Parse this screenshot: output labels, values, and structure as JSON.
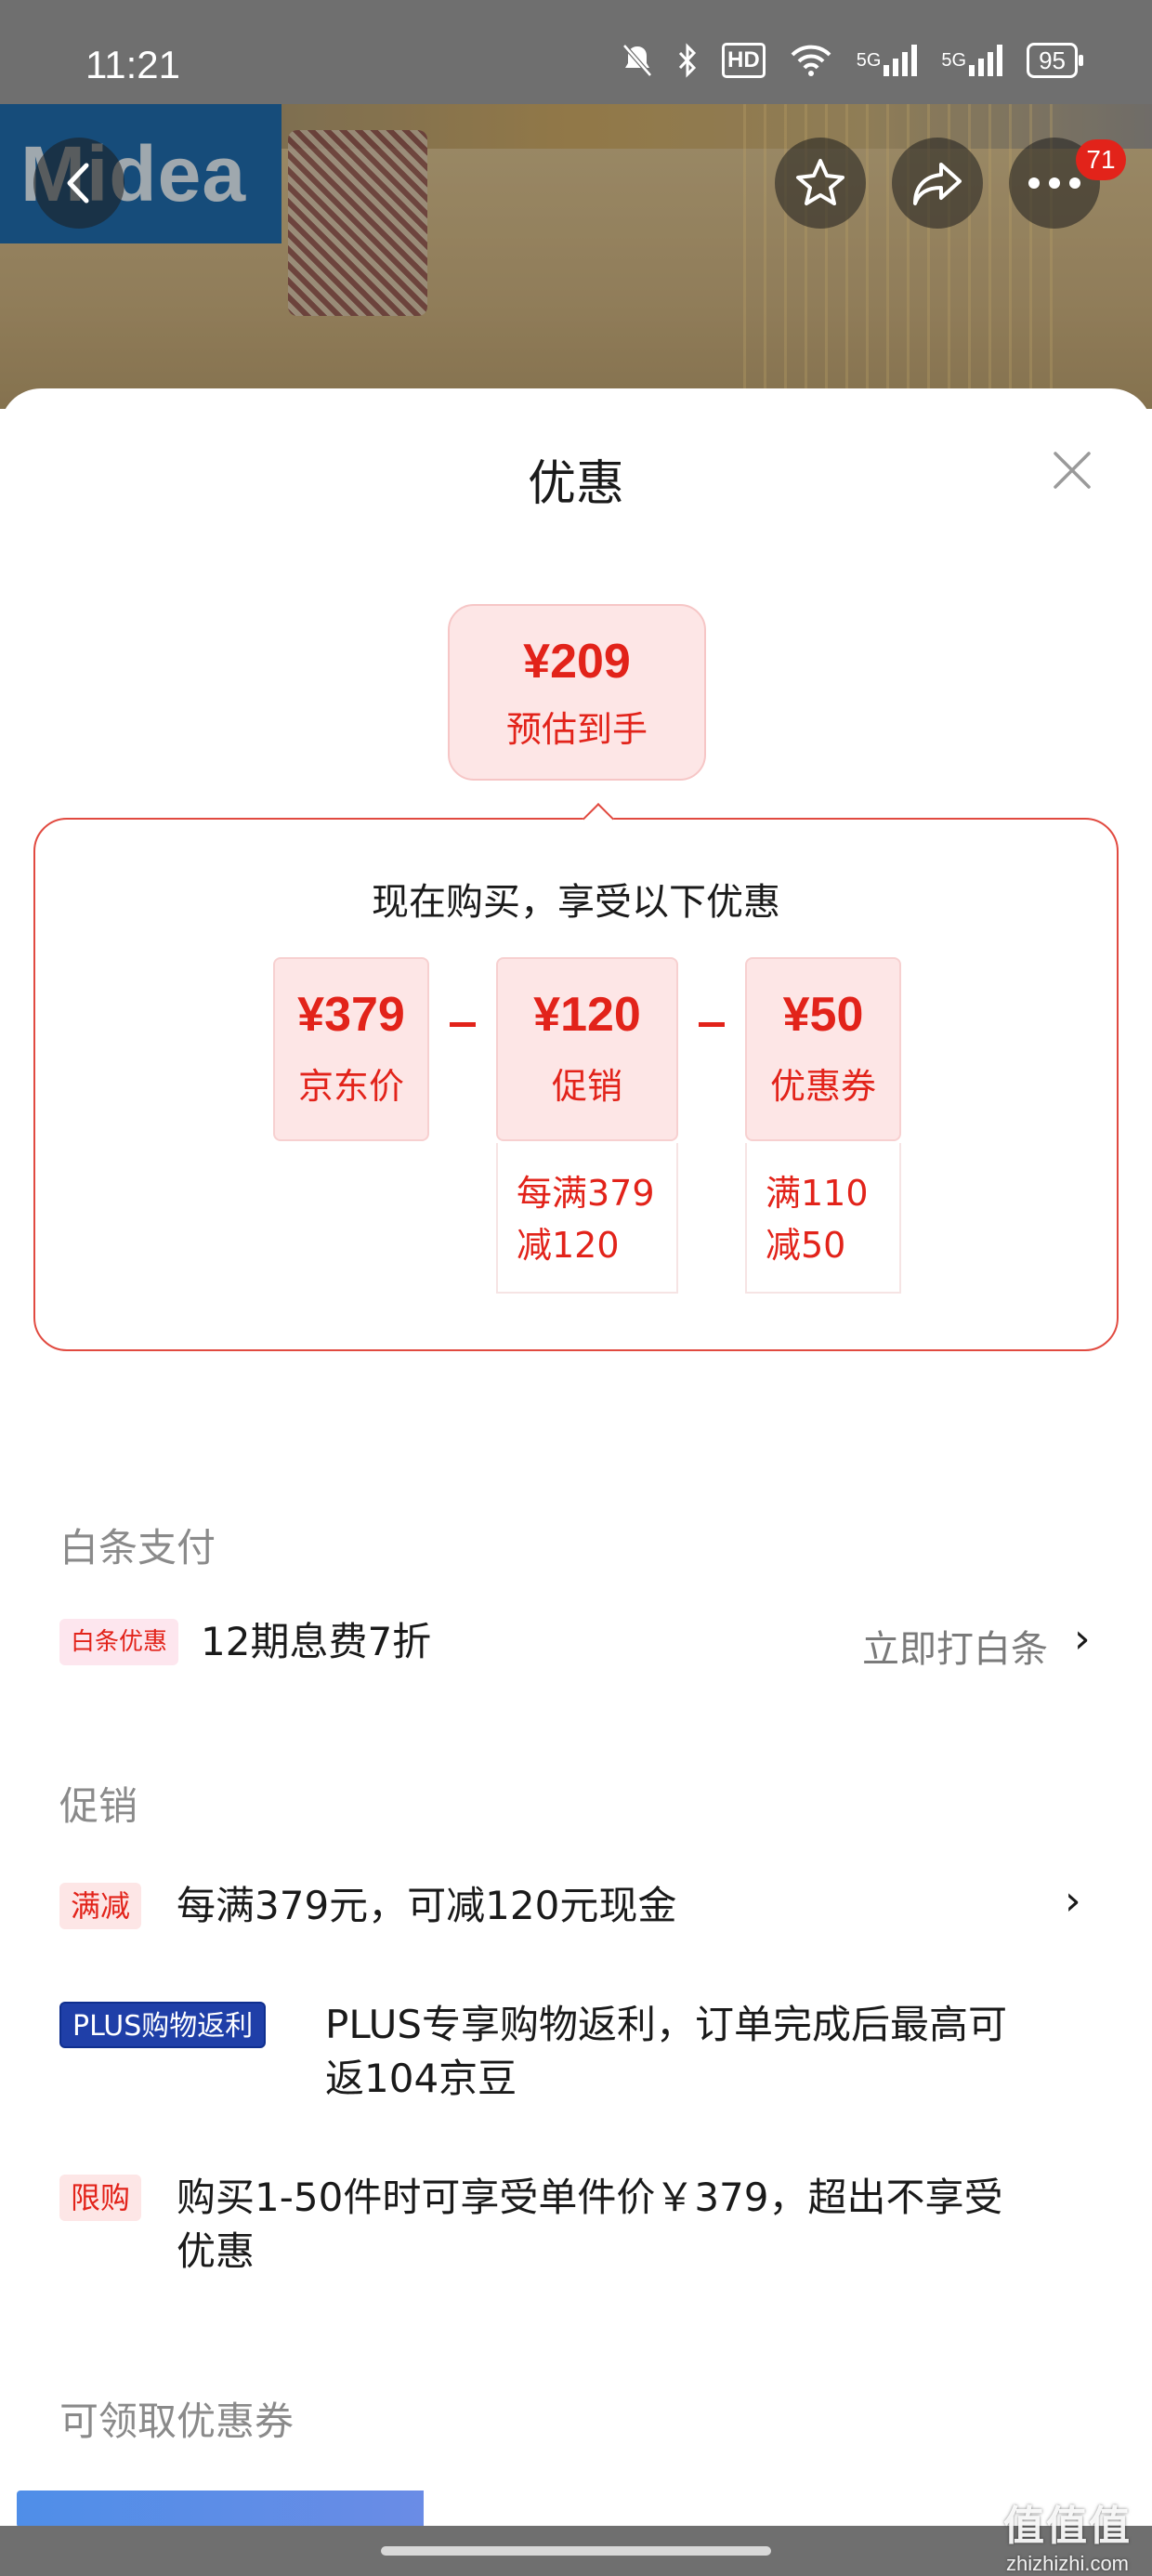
{
  "status_bar": {
    "time": "11:21",
    "battery": "95",
    "hd": "HD",
    "net1": "5G",
    "net2": "5G"
  },
  "header": {
    "brand_logo_text": "Midea",
    "cart_badge": "71"
  },
  "sheet": {
    "title": "优惠"
  },
  "estimate": {
    "price": "¥209",
    "label": "预估到手"
  },
  "calc": {
    "headline": "现在购买，享受以下优惠",
    "items": [
      {
        "value": "¥379",
        "label": "京东价",
        "detail": ""
      },
      {
        "value": "¥120",
        "label": "促销",
        "detail_line1": "每满379",
        "detail_line2": "减120"
      },
      {
        "value": "¥50",
        "label": "优惠券",
        "detail_line1": "满110",
        "detail_line2": "减50"
      }
    ]
  },
  "baitiao": {
    "section_title": "白条支付",
    "tag": "白条优惠",
    "text": "12期息费7折",
    "action": "立即打白条"
  },
  "promotion": {
    "section_title": "促销",
    "rows": [
      {
        "tag": "满减",
        "text": "每满379元，可减120元现金"
      },
      {
        "tag": "PLUS购物返利",
        "text_line1": "PLUS专享购物返利，订单完成后最高可",
        "text_line2": "返104京豆"
      },
      {
        "tag": "限购",
        "text_line1": "购买1-50件时可享受单件价￥379，超出不享受",
        "text_line2": "优惠"
      }
    ]
  },
  "coupons": {
    "section_title": "可领取优惠券"
  },
  "watermark": {
    "main": "值值值",
    "sub": "zhizhizhi.com"
  },
  "colors": {
    "accent": "#e2231a",
    "plus_tag": "#1f3fa8",
    "muted": "#8a8a8a"
  }
}
